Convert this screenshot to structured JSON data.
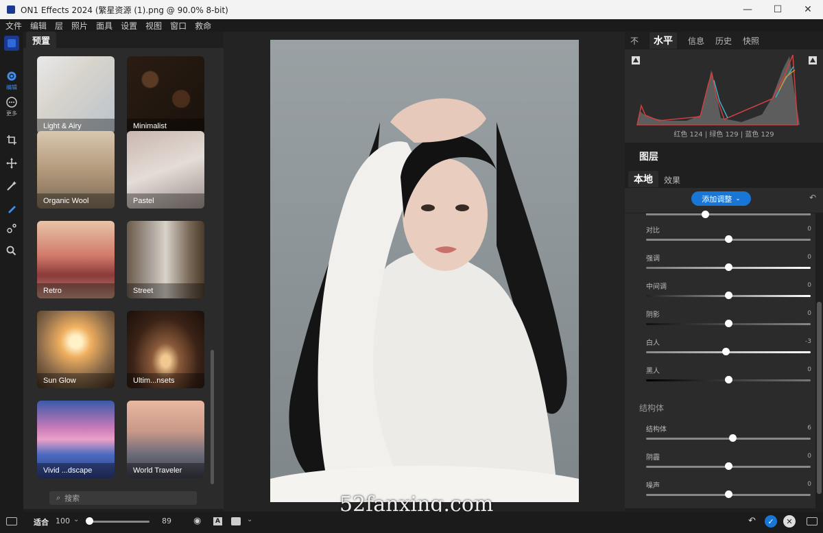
{
  "window": {
    "title": "ON1 Effects 2024 (繁星资源 (1).png @ 90.0% 8-bit)",
    "minimize": "—",
    "maximize": "☐",
    "close": "✕"
  },
  "menu": [
    "文件",
    "编辑",
    "层",
    "照片",
    "面具",
    "设置",
    "视图",
    "窗口",
    "救命"
  ],
  "toolstrip": {
    "edit_label": "编辑",
    "more_label": "更多"
  },
  "presets": {
    "tab_label": "预置",
    "items": [
      {
        "label": "Light & Airy"
      },
      {
        "label": "Minimalist"
      },
      {
        "label": "Organic Wool"
      },
      {
        "label": "Pastel"
      },
      {
        "label": "Retro"
      },
      {
        "label": "Street"
      },
      {
        "label": "Sun Glow"
      },
      {
        "label": "Ultim...nsets"
      },
      {
        "label": "Vivid ...dscape"
      },
      {
        "label": "World Traveler"
      }
    ],
    "search_placeholder": "搜索"
  },
  "watermark": "52fanxing.com",
  "right": {
    "tabs": [
      "不",
      "水平",
      "信息",
      "历史",
      "快照"
    ],
    "active_tab": "水平",
    "histogram_readout": "红色 124 | 绿色 129 | 蓝色 129",
    "layers_title": "图层",
    "layer_tabs": [
      "本地",
      "效果"
    ],
    "add_adjustment": "添加调整",
    "section_structure": "结构体",
    "sliders": [
      {
        "label": "对比",
        "value": "0",
        "position": 0.5
      },
      {
        "label": "强调",
        "value": "0",
        "position": 0.5
      },
      {
        "label": "中间调",
        "value": "0",
        "position": 0.5
      },
      {
        "label": "阴影",
        "value": "0",
        "position": 0.5
      },
      {
        "label": "白人",
        "value": "-3",
        "position": 0.485
      },
      {
        "label": "黑人",
        "value": "0",
        "position": 0.5
      },
      {
        "label": "结构体",
        "value": "6",
        "position": 0.525
      },
      {
        "label": "阴霾",
        "value": "0",
        "position": 0.5
      },
      {
        "label": "噪声",
        "value": "0",
        "position": 0.5
      }
    ]
  },
  "statusbar": {
    "fit": "适合",
    "zoom": "100",
    "value": "89"
  },
  "colors": {
    "accent": "#1877d6",
    "panel": "#2b2b2b",
    "background": "#1f1f1f"
  }
}
